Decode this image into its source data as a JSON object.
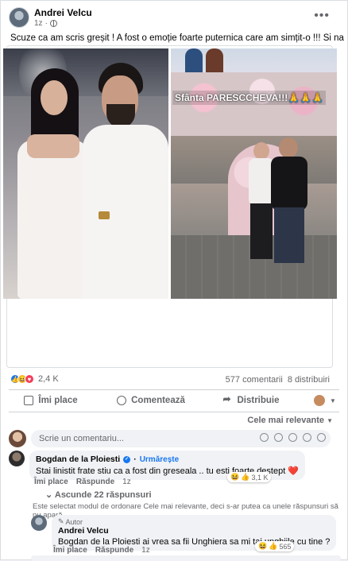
{
  "post": {
    "author": "Andrei Velcu",
    "time": "1z",
    "privacy_icon": "globe-icon",
    "text": "Scuze ca am scris greșit ! A fost o emoție foarte puternica care am simțit-o !!! Si na ..",
    "photo_caption": "Sfânta PARESCCHEVA!!!🙏🙏🙏",
    "reaction_count": "2,4 K",
    "comments_count": "577 comentarii",
    "shares_count": "8 distribuiri"
  },
  "actions": {
    "like": "Îmi place",
    "comment": "Comentează",
    "share": "Distribuie"
  },
  "sort_label": "Cele mai relevante",
  "comment_box": {
    "placeholder": "Scrie un comentariu..."
  },
  "comments": [
    {
      "author": "Bogdan de la Ploiesti",
      "follow": "Urmărește",
      "text": "Stai linistit frate stiu ca a fost din greseala .. tu esti foarte destept ❤️",
      "like": "Îmi place",
      "reply": "Răspunde",
      "time": "1z",
      "reactions": "3,1 K"
    }
  ],
  "replies_toggle": "Ascunde 22 răspunsuri",
  "sort_notice": "Este selectat modul de ordonare Cele mai relevante, deci s-ar putea ca unele răspunsuri să nu apară.",
  "reply": {
    "badge": "Autor",
    "author": "Andrei Velcu",
    "text": "Bogdan de la Ploiesti ai vrea sa fii Unghiera sa mi tai unghiile cu tine ?",
    "like": "Îmi place",
    "reply": "Răspunde",
    "time": "1z",
    "reactions": "565"
  },
  "colors": {
    "accent": "#1877f2",
    "muted": "#65676b",
    "bubble": "#f0f2f5"
  }
}
